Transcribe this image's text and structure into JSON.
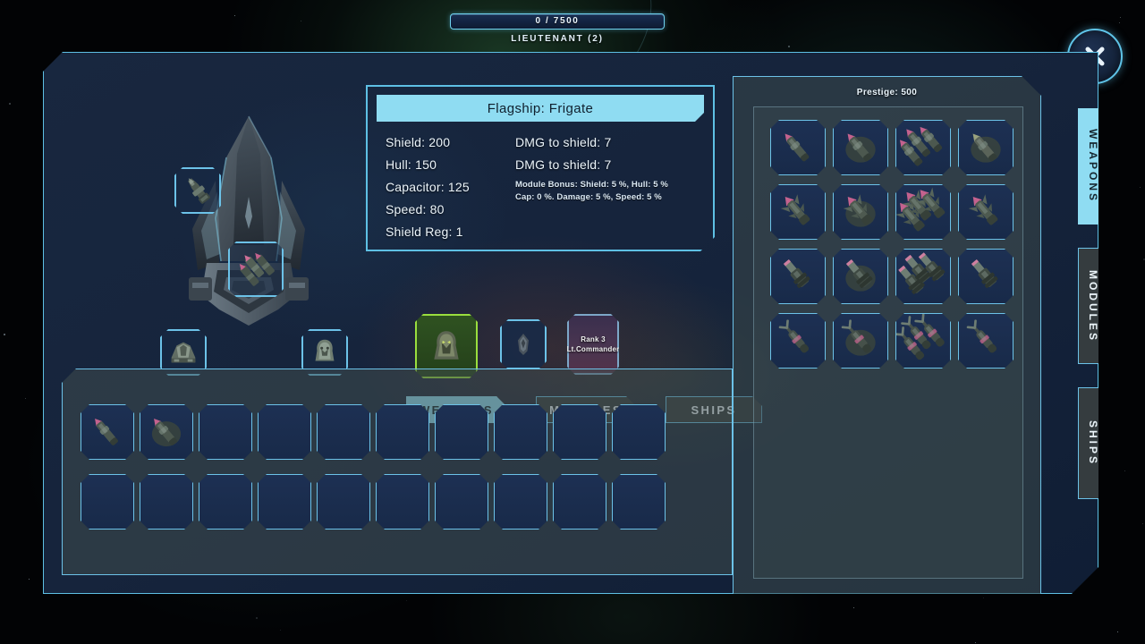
{
  "topbar": {
    "xp_text": "0 / 7500",
    "xp_current": 0,
    "xp_max": 7500,
    "rank_text": "LIEUTENANT (2)"
  },
  "close_button": {
    "label": "close"
  },
  "stats": {
    "title": "Flagship: Frigate",
    "left_column": [
      "Shield: 200",
      "Hull: 150",
      "Capacitor: 125",
      "Speed: 80",
      "Shield Reg: 1"
    ],
    "right_column": [
      "DMG to shield: 7",
      "DMG to shield: 7"
    ],
    "bonus_lines": [
      "Module Bonus:  Shield: 5 %, Hull: 5 %",
      "Cap: 0 %. Damage: 5 %, Speed: 5 %"
    ]
  },
  "crew": {
    "rank_line1": "Rank 3",
    "rank_line2": "Lt.Commander"
  },
  "tabs": [
    {
      "label": "WEAPONS",
      "active": true
    },
    {
      "label": "MODULES",
      "active": false
    },
    {
      "label": "SHIPS",
      "active": false
    }
  ],
  "side_tabs": [
    {
      "label": "WEAPONS",
      "active": true
    },
    {
      "label": "MODULES",
      "active": false
    },
    {
      "label": "SHIPS",
      "active": false
    }
  ],
  "store": {
    "prestige_label": "Prestige: 500",
    "prestige_value": 500,
    "columns": 4,
    "rows": 4,
    "items": [
      {
        "filled": true,
        "art": "a"
      },
      {
        "filled": true,
        "art": "b"
      },
      {
        "filled": true,
        "art": "c"
      },
      {
        "filled": true,
        "art": "d"
      },
      {
        "filled": true,
        "art": "e"
      },
      {
        "filled": true,
        "art": "f"
      },
      {
        "filled": true,
        "art": "g"
      },
      {
        "filled": true,
        "art": "h"
      },
      {
        "filled": true,
        "art": "i"
      },
      {
        "filled": true,
        "art": "j"
      },
      {
        "filled": true,
        "art": "k"
      },
      {
        "filled": true,
        "art": "l"
      },
      {
        "filled": true,
        "art": "m"
      },
      {
        "filled": true,
        "art": "n"
      },
      {
        "filled": true,
        "art": "o"
      },
      {
        "filled": true,
        "art": "p"
      }
    ]
  },
  "inventory": {
    "columns": 10,
    "rows": 2,
    "items": [
      {
        "filled": true,
        "art": "a"
      },
      {
        "filled": true,
        "art": "b"
      },
      {
        "filled": false
      },
      {
        "filled": false
      },
      {
        "filled": false
      },
      {
        "filled": false
      },
      {
        "filled": false
      },
      {
        "filled": false
      },
      {
        "filled": false
      },
      {
        "filled": false
      },
      {
        "filled": false
      },
      {
        "filled": false
      },
      {
        "filled": false
      },
      {
        "filled": false
      },
      {
        "filled": false
      },
      {
        "filled": false
      },
      {
        "filled": false
      },
      {
        "filled": false
      },
      {
        "filled": false
      },
      {
        "filled": false
      }
    ]
  },
  "hardpoints": [
    {
      "id": "hp-1",
      "filled": true,
      "art": "a"
    },
    {
      "id": "hp-2",
      "filled": true,
      "art": "c"
    },
    {
      "id": "hp-3",
      "filled": true,
      "art": "engine"
    },
    {
      "id": "hp-4",
      "filled": true,
      "art": "crew"
    }
  ],
  "colors": {
    "accent_cyan": "#8fdcf2",
    "border_cyan": "#6cc2e8",
    "panel_dark": "#15264a",
    "selected_green": "#9ade3e",
    "slot_fill": "#1d3053"
  }
}
